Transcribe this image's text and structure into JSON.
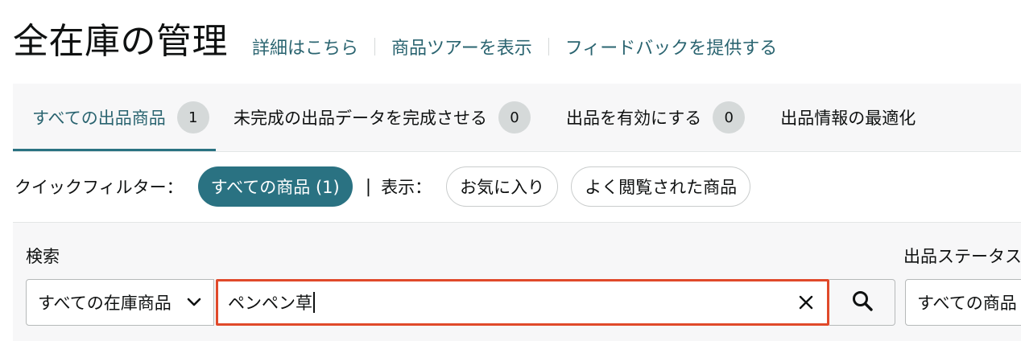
{
  "header": {
    "title": "全在庫の管理",
    "links": [
      "詳細はこちら",
      "商品ツアーを表示",
      "フィードバックを提供する"
    ]
  },
  "tabs": [
    {
      "label": "すべての出品商品",
      "count": "1",
      "active": true
    },
    {
      "label": "未完成の出品データを完成させる",
      "count": "0",
      "active": false
    },
    {
      "label": "出品を有効にする",
      "count": "0",
      "active": false
    },
    {
      "label": "出品情報の最適化",
      "count": "",
      "active": false
    }
  ],
  "quick_filters": {
    "label": "クイックフィルター：",
    "selected_chip": "すべての商品 (1)",
    "separator": "|",
    "show_label": "表示：",
    "chips": [
      "お気に入り",
      "よく閲覧された商品"
    ]
  },
  "search": {
    "label": "検索",
    "scope_value": "すべての在庫商品",
    "query": "ペンペン草"
  },
  "status_filter": {
    "label": "出品ステータス",
    "value": "すべての商品"
  },
  "colors": {
    "accent": "#2a7282",
    "link": "#2a6470",
    "focus_border": "#e0492a",
    "panel_bg": "#f7f7f8"
  },
  "icons": {
    "scope_chevron": "chevron-down-icon",
    "clear": "close-icon",
    "search": "search-icon"
  }
}
